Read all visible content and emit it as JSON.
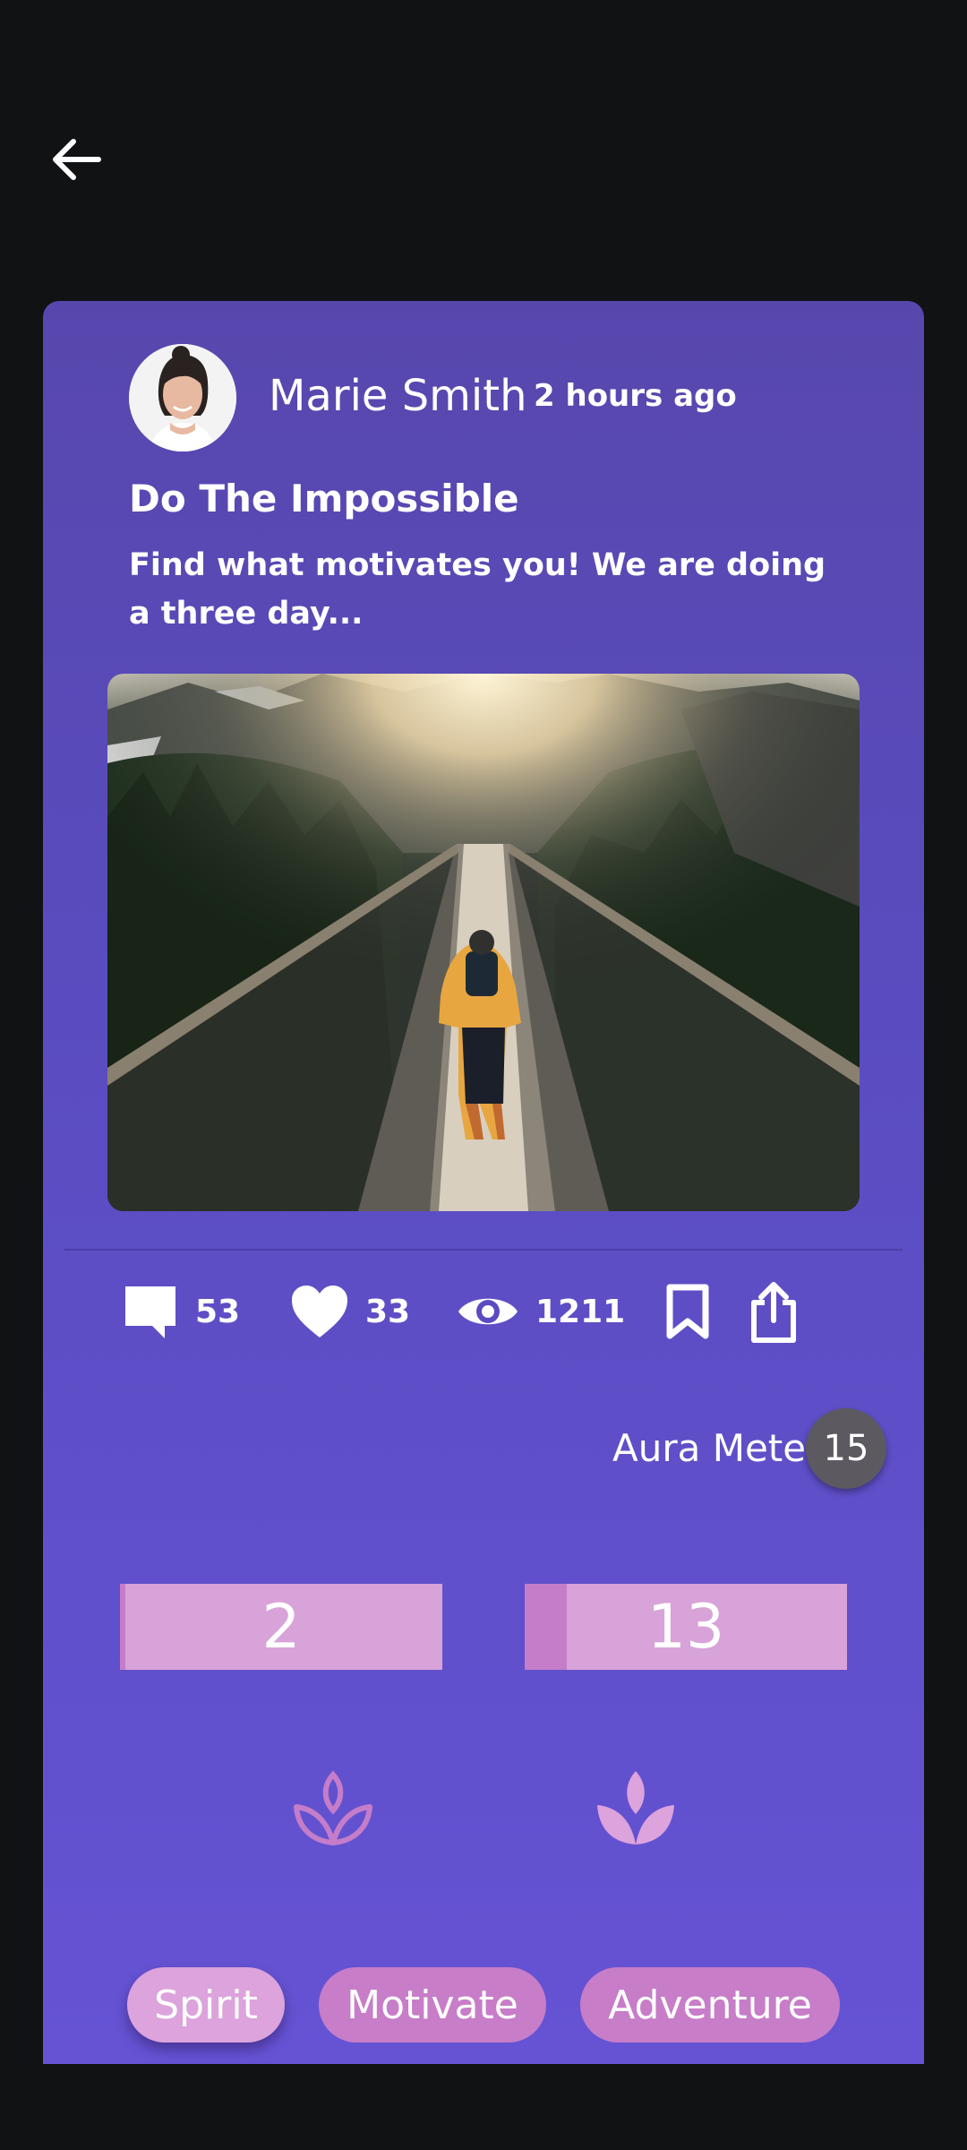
{
  "post": {
    "author": "Marie Smith",
    "time": "2 hours ago",
    "title": "Do The Impossible",
    "excerpt": "Find what motivates you! We are doing a three day..."
  },
  "stats": {
    "comments": "53",
    "likes": "33",
    "views": "1211"
  },
  "aura": {
    "label": "Aura Meter",
    "value": "15"
  },
  "votes": {
    "left": {
      "value": "2",
      "fill_fraction": 0.0154
    },
    "right": {
      "value": "13",
      "fill_fraction": 0.13
    }
  },
  "tags": [
    "Spirit",
    "Motivate",
    "Adventure"
  ],
  "icons": {
    "back": "arrow-left-icon",
    "comment": "comment-icon",
    "like": "heart-icon",
    "views": "eye-icon",
    "bookmark": "bookmark-icon",
    "share": "share-icon",
    "lotus_outline": "lotus-outline-icon",
    "lotus_filled": "lotus-filled-icon"
  },
  "colors": {
    "background": "#111214",
    "card_top": "#5747ad",
    "card_bottom": "#6553d4",
    "vote_bar": "#d8a3d8",
    "vote_fill": "#c57dc9",
    "tag": "#c77dc8",
    "tag_active": "#dca3dc",
    "badge": "#5c5961"
  }
}
